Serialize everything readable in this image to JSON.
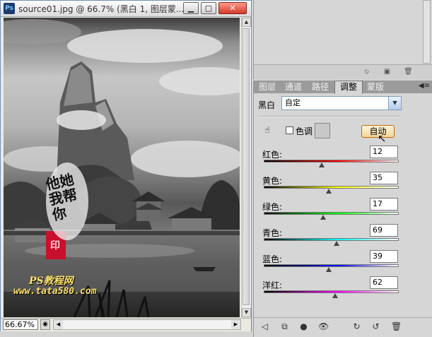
{
  "document": {
    "title": "source01.jpg @ 66.7% (黑白 1, 图层蒙...",
    "app_icon": "Ps",
    "zoom": "66.67%",
    "window_buttons": [
      "minimize-icon",
      "restore-icon",
      "close-icon"
    ]
  },
  "artwork": {
    "calligraphy": "他她我帮你",
    "seal": "印",
    "watermark_line1": "PS教程网",
    "watermark_line2": "www.tata580.com"
  },
  "tabs": [
    {
      "label": "图层",
      "active": false
    },
    {
      "label": "通道",
      "active": false
    },
    {
      "label": "路径",
      "active": false
    },
    {
      "label": "调整",
      "active": true
    },
    {
      "label": "蒙版",
      "active": false
    }
  ],
  "adjustment": {
    "preset_label": "黑白",
    "preset_value": "自定",
    "tint_label": "色调",
    "tint_checked": false,
    "auto_label": "自动",
    "sliders": [
      {
        "label": "红色:",
        "value": "12",
        "position": 0.43,
        "colors": [
          "#000000",
          "#ff0000"
        ]
      },
      {
        "label": "黄色:",
        "value": "35",
        "position": 0.48,
        "colors": [
          "#000000",
          "#ffff00"
        ]
      },
      {
        "label": "绿色:",
        "value": "17",
        "position": 0.44,
        "colors": [
          "#000000",
          "#00ff00"
        ]
      },
      {
        "label": "青色:",
        "value": "69",
        "position": 0.54,
        "colors": [
          "#000000",
          "#00ffff"
        ]
      },
      {
        "label": "蓝色:",
        "value": "39",
        "position": 0.48,
        "colors": [
          "#000000",
          "#0000ff"
        ]
      },
      {
        "label": "洋红:",
        "value": "62",
        "position": 0.53,
        "colors": [
          "#000000",
          "#ff00ff"
        ]
      }
    ]
  },
  "colors": {
    "title_bar": "#dcdcdc",
    "panel_bg": "#d6d6d6",
    "tab_bar": "#9b9b9b",
    "auto_button_border": "#c46a00"
  }
}
